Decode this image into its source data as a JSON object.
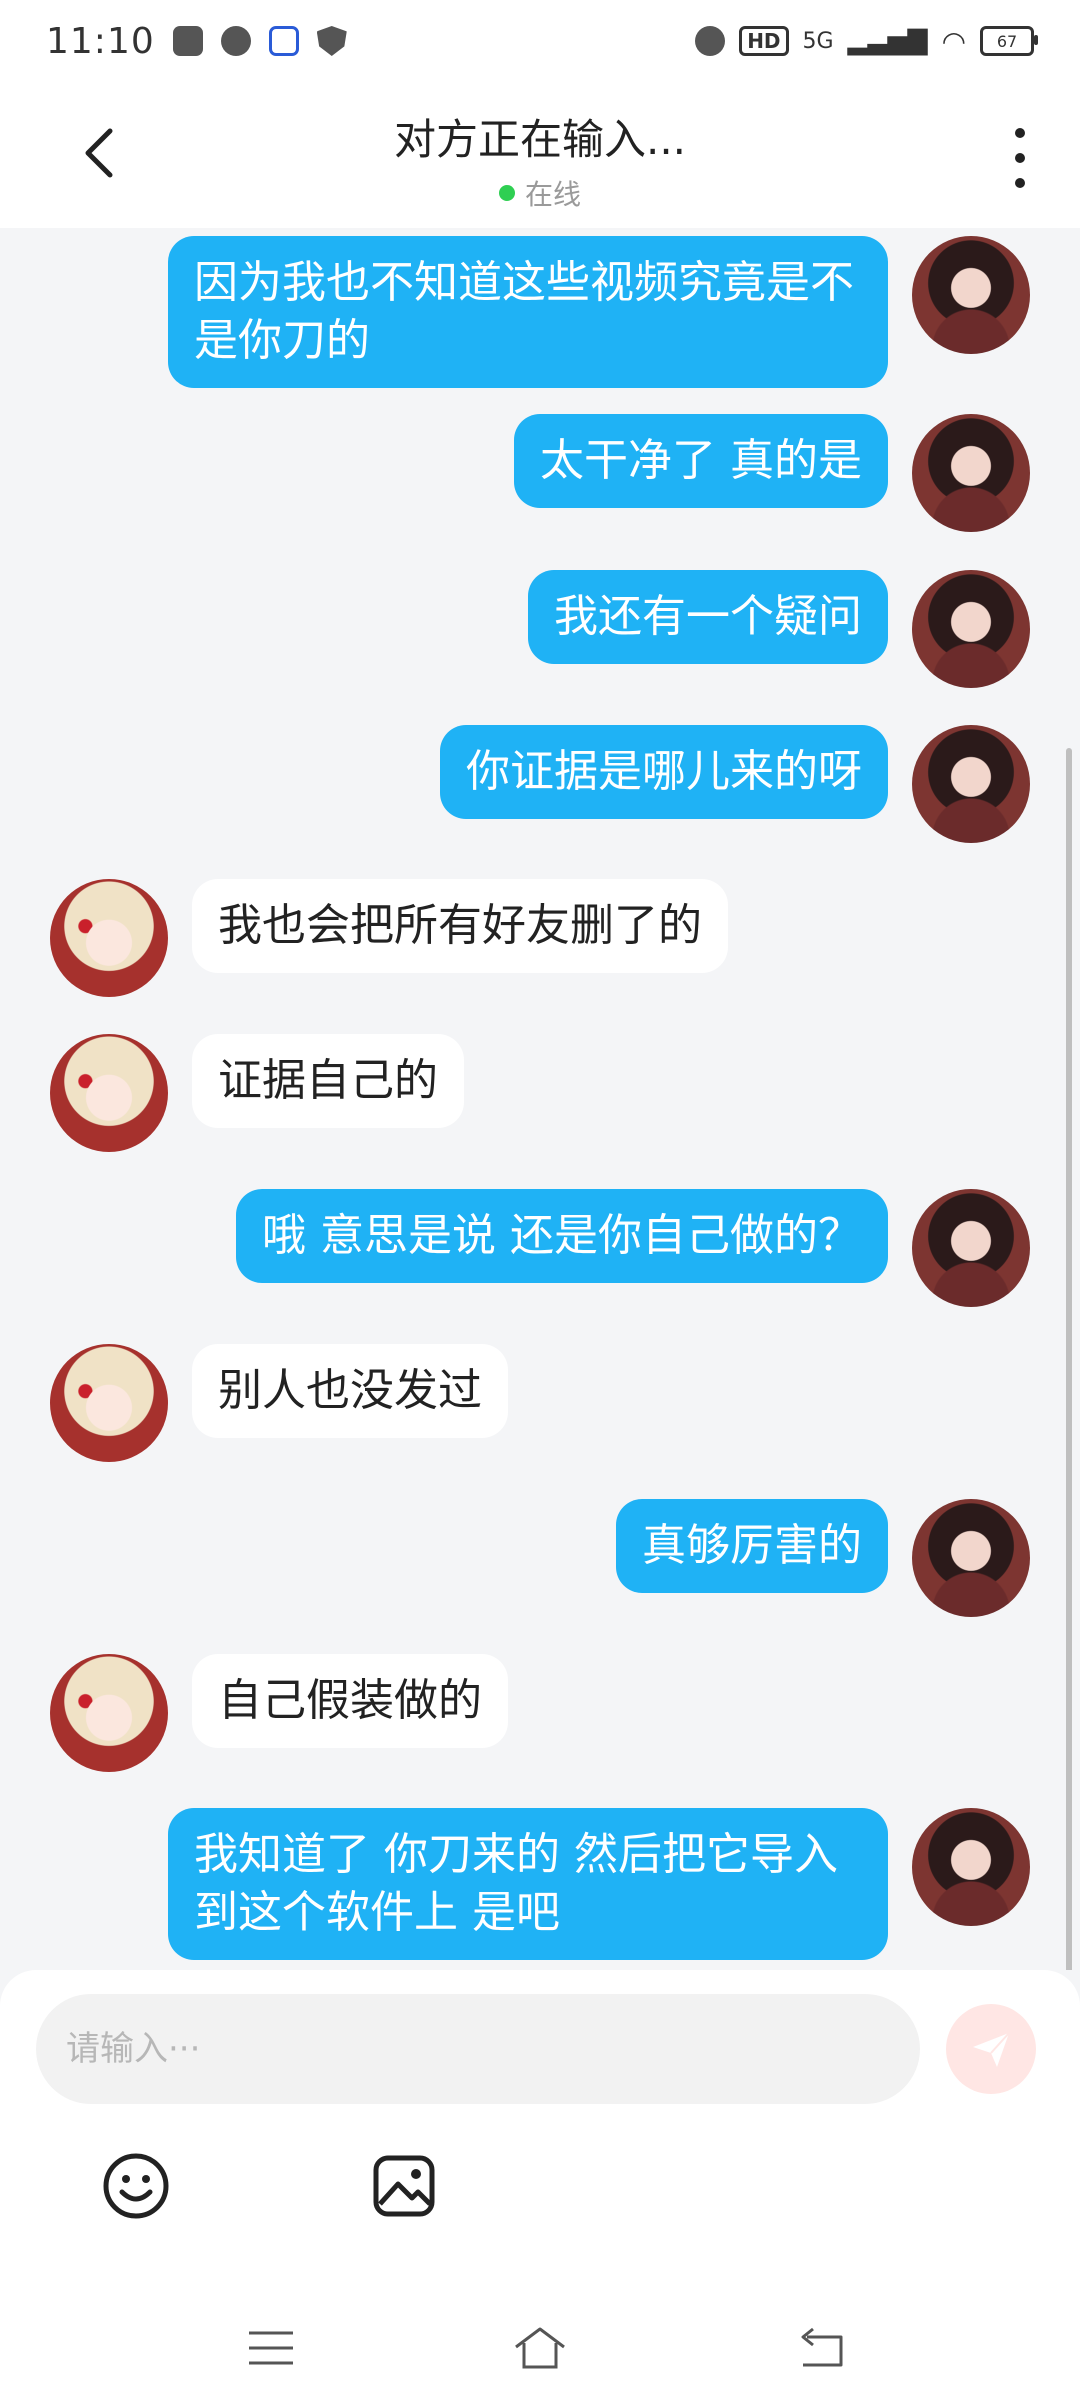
{
  "status_bar": {
    "time": "11:10",
    "hd": "HD",
    "network": "5G",
    "battery": "67"
  },
  "header": {
    "title": "对方正在输入...",
    "status": "在线"
  },
  "messages": [
    {
      "sender": "me",
      "text": "因为我也不知道这些视频究竟是不是你刀的"
    },
    {
      "sender": "me",
      "text": "太干净了  真的是"
    },
    {
      "sender": "me",
      "text": "我还有一个疑问"
    },
    {
      "sender": "me",
      "text": "你证据是哪儿来的呀"
    },
    {
      "sender": "other",
      "text": "我也会把所有好友删了的"
    },
    {
      "sender": "other",
      "text": "证据自己的"
    },
    {
      "sender": "me",
      "text": "哦  意思是说  还是你自己做的？"
    },
    {
      "sender": "other",
      "text": "别人也没发过"
    },
    {
      "sender": "me",
      "text": "真够厉害的"
    },
    {
      "sender": "other",
      "text": "自己假装做的"
    },
    {
      "sender": "me",
      "text": "我知道了  你刀来的  然后把它导入到这个软件上  是吧"
    }
  ],
  "composer": {
    "placeholder": "请输入···",
    "value": ""
  },
  "icons": {
    "back": "chevron-left-icon",
    "more": "more-vertical-icon",
    "send": "send-icon",
    "emoji": "emoji-icon",
    "image": "image-icon"
  },
  "colors": {
    "my_bubble": "#1fb2f5",
    "other_bubble": "#ffffff",
    "online_dot": "#2fcf52",
    "send_button": "#ffe6e4"
  }
}
